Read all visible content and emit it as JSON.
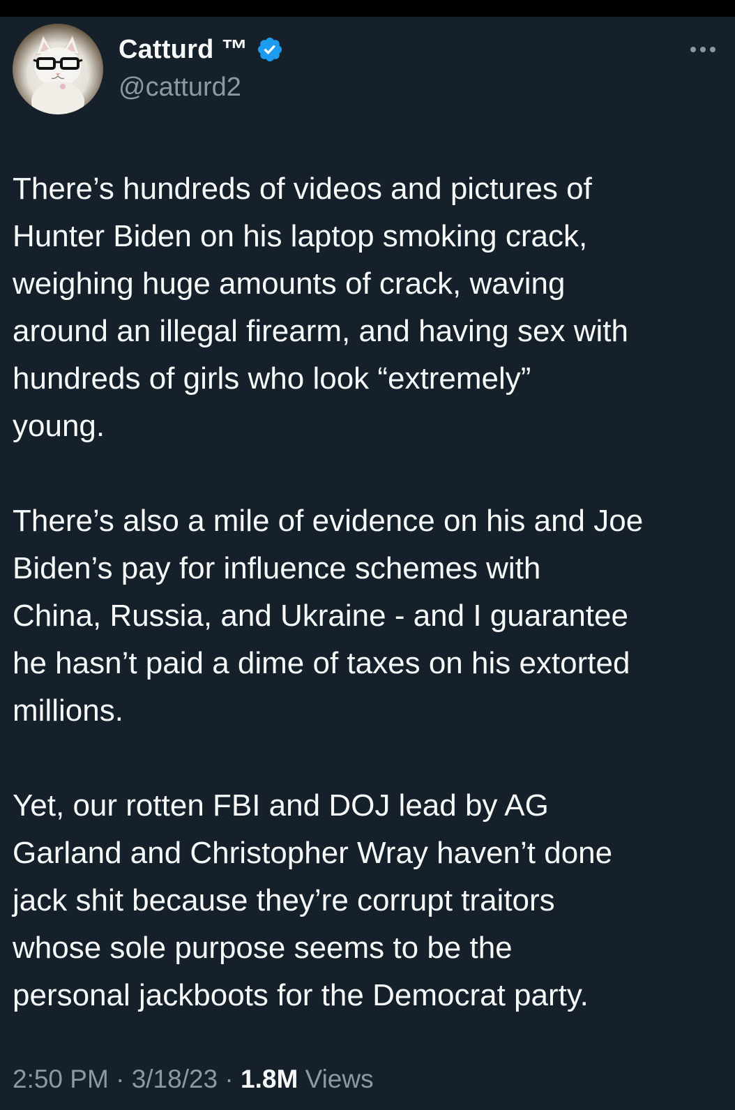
{
  "author": {
    "display_name": "Catturd ™",
    "handle": "@catturd2",
    "verified": true
  },
  "tweet": {
    "paragraphs": [
      [
        "There’s hundreds of videos and pictures  of",
        "Hunter Biden on his laptop smoking crack,",
        "weighing huge amounts of crack, waving",
        "around an illegal firearm, and having sex with",
        "hundreds of girls who look “extremely”",
        "young."
      ],
      [
        "There’s also a mile of evidence on his and Joe",
        "Biden’s pay for influence schemes with",
        "China, Russia, and Ukraine - and I guarantee",
        "he hasn’t paid a dime of taxes on his extorted",
        "millions."
      ],
      [
        "Yet, our rotten FBI and DOJ lead by AG",
        "Garland and Christopher Wray haven’t done",
        "jack shit because they’re corrupt traitors",
        "whose sole purpose seems to be the",
        "personal jackboots for the Democrat party."
      ]
    ]
  },
  "meta": {
    "time": "2:50 PM",
    "separator": "·",
    "date": "3/18/23",
    "views_count": "1.8M",
    "views_label": "Views"
  },
  "colors": {
    "background": "#15202b",
    "text_primary": "#f7f9f9",
    "text_secondary": "#8b98a5",
    "verified_blue": "#1d9bf0"
  },
  "icons": {
    "verified": "verified-badge-icon",
    "more": "more-options-icon"
  }
}
